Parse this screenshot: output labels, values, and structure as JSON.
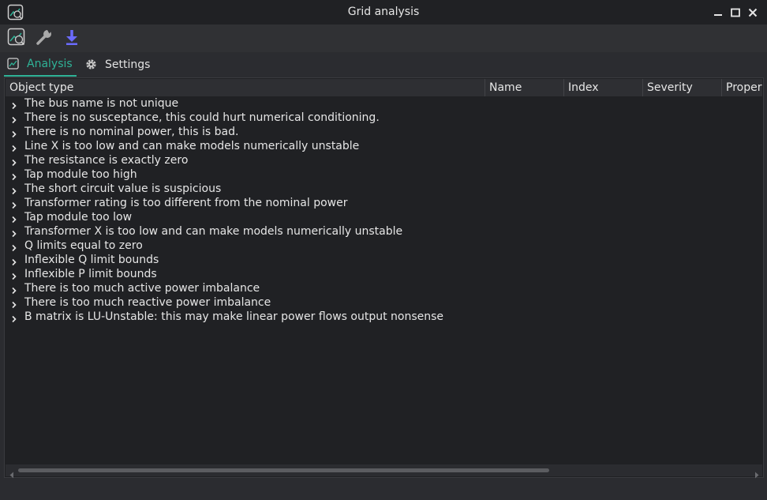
{
  "window": {
    "title": "Grid analysis",
    "app_icon": "grid-analysis-icon",
    "controls": [
      "minimize-icon",
      "maximize-icon",
      "close-icon"
    ]
  },
  "toolbar": {
    "buttons": [
      {
        "icon": "grid-analysis-icon"
      },
      {
        "icon": "wrench-icon"
      },
      {
        "icon": "download-icon"
      }
    ]
  },
  "tabs": [
    {
      "label": "Analysis",
      "icon": "image-icon",
      "active": true
    },
    {
      "label": "Settings",
      "icon": "gear-icon",
      "active": false
    }
  ],
  "table": {
    "columns": [
      "Object type",
      "Name",
      "Index",
      "Severity",
      "Proper"
    ],
    "rows": [
      "The bus name is not unique",
      "There is no susceptance, this could hurt numerical conditioning.",
      "There is no nominal power, this is bad.",
      "Line X is too low and can make models numerically unstable",
      "The resistance is exactly zero",
      "Tap module too high",
      "The short circuit value is suspicious",
      "Transformer rating is too different from the nominal power",
      "Tap module too low",
      "Transformer X is too low and can make models numerically unstable",
      "Q limits equal to zero",
      "Inflexible Q limit bounds",
      "Inflexible P limit bounds",
      "There is too much active power imbalance",
      "There is too much reactive power imbalance",
      "B matrix is LU-Unstable: this may make linear power flows output nonsense"
    ]
  },
  "colors": {
    "accent": "#2fb397",
    "download": "#6b6bff",
    "background": "#202124"
  }
}
